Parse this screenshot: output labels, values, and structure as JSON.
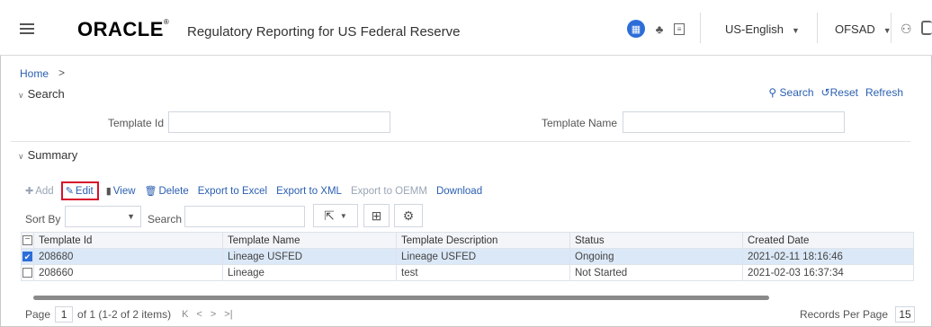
{
  "header": {
    "brand": "ORACLE",
    "brand_mark": "®",
    "app_title": "Regulatory Reporting for US Federal Reserve",
    "language": "US-English",
    "user": "OFSAD"
  },
  "breadcrumb": {
    "home": "Home",
    "separator": ">"
  },
  "search": {
    "title": "Search",
    "actions": {
      "search": "Search",
      "reset": "Reset",
      "refresh": "Refresh"
    },
    "fields": {
      "template_id_label": "Template Id",
      "template_name_label": "Template Name"
    }
  },
  "summary": {
    "title": "Summary",
    "toolbar": {
      "add": "Add",
      "edit": "Edit",
      "view": "View",
      "delete": "Delete",
      "export_excel": "Export to Excel",
      "export_xml": "Export to XML",
      "export_oemm": "Export to OEMM",
      "download": "Download"
    },
    "sort_by_label": "Sort By",
    "search_label": "Search",
    "columns": [
      "Template Id",
      "Template Name",
      "Template Description",
      "Status",
      "Created Date"
    ],
    "rows": [
      {
        "id": "208680",
        "name": "Lineage USFED",
        "description": "Lineage USFED",
        "status": "Ongoing",
        "created": "2021-02-11 18:16:46",
        "selected": true
      },
      {
        "id": "208660",
        "name": "Lineage",
        "description": "test",
        "status": "Not Started",
        "created": "2021-02-03 16:37:34",
        "selected": false
      }
    ]
  },
  "pager": {
    "page_label": "Page",
    "page": "1",
    "info": "of 1 (1-2 of 2 items)",
    "records_per_page_label": "Records Per Page",
    "records_per_page": "15"
  },
  "colors": {
    "link": "#2a5fb0",
    "accent": "#2d6dd8",
    "highlight": "#d8102a",
    "selected_row": "#dbe8f7"
  }
}
